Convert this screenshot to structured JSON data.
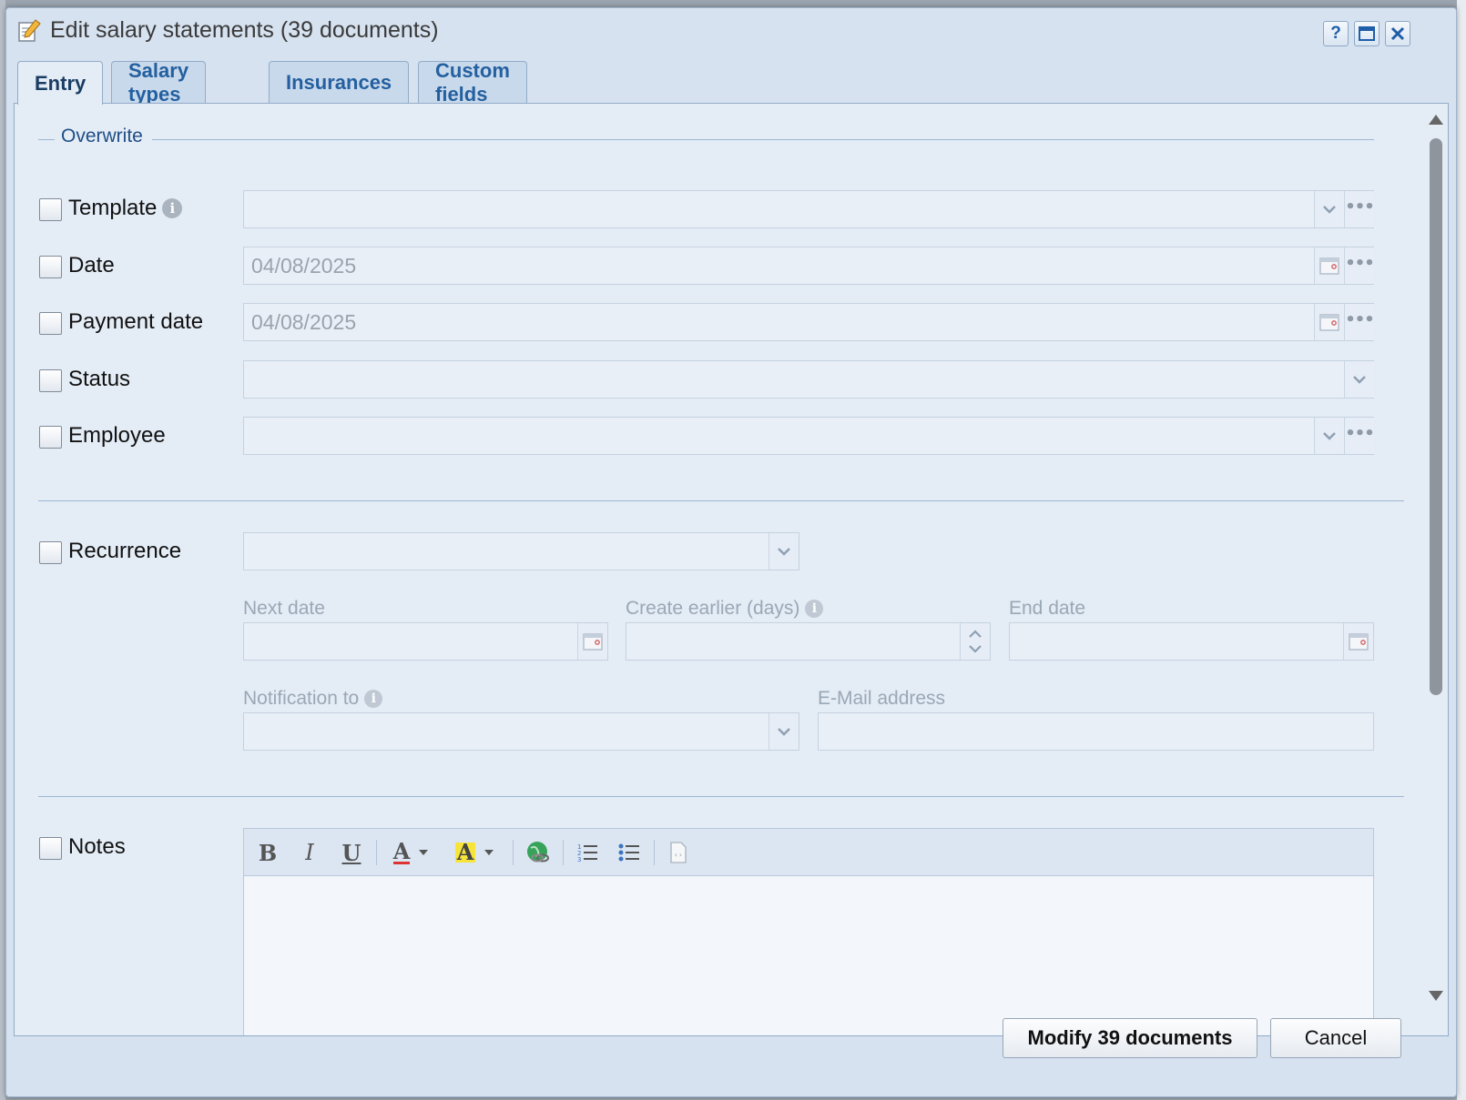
{
  "dialog": {
    "title": "Edit salary statements (39 documents)",
    "buttons": {
      "help": "?",
      "maximize": "maximize-icon",
      "close": "close-icon"
    }
  },
  "tabs": [
    {
      "label": "Entry",
      "active": true
    },
    {
      "label": "Salary types",
      "active": false
    },
    {
      "label": "Insurances",
      "active": false
    },
    {
      "label": "Custom fields",
      "active": false
    }
  ],
  "overwrite": {
    "legend": "Overwrite",
    "fields": {
      "template": {
        "label": "Template",
        "value": ""
      },
      "date": {
        "label": "Date",
        "value": "04/08/2025"
      },
      "payment_date": {
        "label": "Payment date",
        "value": "04/08/2025"
      },
      "status": {
        "label": "Status",
        "value": ""
      },
      "employee": {
        "label": "Employee",
        "value": ""
      }
    }
  },
  "recurrence": {
    "label": "Recurrence",
    "value": "",
    "next_date": {
      "label": "Next date",
      "value": ""
    },
    "create_earlier": {
      "label": "Create earlier (days)",
      "value": ""
    },
    "end_date": {
      "label": "End date",
      "value": ""
    },
    "notification_to": {
      "label": "Notification to",
      "value": ""
    },
    "email": {
      "label": "E-Mail address",
      "value": ""
    }
  },
  "notes": {
    "label": "Notes",
    "toolbar": [
      "bold",
      "italic",
      "underline",
      "font-color",
      "highlight-color",
      "insert-link",
      "ordered-list",
      "unordered-list",
      "source-edit"
    ],
    "toolbar_glyphs": {
      "bold": "B",
      "italic": "I",
      "underline": "U",
      "font_color": "A",
      "highlight": "A"
    }
  },
  "footer": {
    "modify_label": "Modify 39 documents",
    "cancel_label": "Cancel"
  },
  "colors": {
    "dialog_bg": "#d6e2f0",
    "panel_bg": "#e4ecf6",
    "tab_text": "#24609f",
    "accent_blue": "#1f5ea8"
  }
}
